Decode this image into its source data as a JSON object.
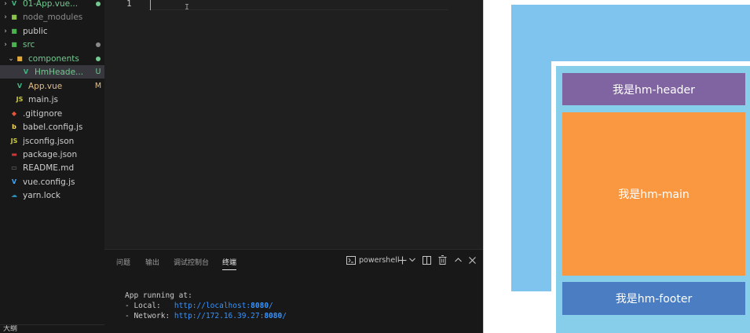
{
  "explorer": {
    "items": [
      {
        "label": "01-App.vue...",
        "type": "vue",
        "color": "green",
        "dot": "#73c991",
        "chevron": "›"
      },
      {
        "label": "node_modules",
        "type": "folder-node",
        "color": "gray",
        "chevron": "›"
      },
      {
        "label": "public",
        "type": "folder-public",
        "color": "",
        "chevron": "›"
      },
      {
        "label": "src",
        "type": "folder-src",
        "color": "green",
        "dot": "#8a8a8a",
        "chevron": "›"
      },
      {
        "label": "components",
        "type": "folder-components",
        "color": "green",
        "dot": "#73c991",
        "chevron": "⌄"
      },
      {
        "label": "HmHeade...",
        "type": "vue",
        "color": "green",
        "badge": "U",
        "badge_color": "green",
        "selected": true
      },
      {
        "label": "App.vue",
        "type": "vue",
        "color": "orange",
        "badge": "M",
        "badge_color": "orange"
      },
      {
        "label": "main.js",
        "type": "js",
        "color": ""
      },
      {
        "label": ".gitignore",
        "type": "git",
        "color": ""
      },
      {
        "label": "babel.config.js",
        "type": "babel",
        "color": ""
      },
      {
        "label": "jsconfig.json",
        "type": "js",
        "color": ""
      },
      {
        "label": "package.json",
        "type": "npm",
        "color": ""
      },
      {
        "label": "README.md",
        "type": "info",
        "color": ""
      },
      {
        "label": "vue.config.js",
        "type": "vue-config",
        "color": ""
      },
      {
        "label": "yarn.lock",
        "type": "yarn",
        "color": ""
      }
    ],
    "outline_label": "大纲"
  },
  "editor": {
    "line_number": "1",
    "ibeam": "I"
  },
  "panel": {
    "tabs": [
      "问题",
      "输出",
      "调试控制台",
      "终端"
    ],
    "active_tab": 3,
    "shell_label": "powershell",
    "terminal": {
      "line1": "App running at:",
      "local_label": "- Local:   ",
      "local_url": "http://localhost:",
      "local_port": "8080",
      "local_tail": "/",
      "network_label": "- Network: ",
      "network_url": "http://172.16.39.27:",
      "network_port": "8080",
      "network_tail": "/"
    }
  },
  "preview": {
    "header_text": "我是hm-header",
    "main_text": "我是hm-main",
    "footer_text": "我是hm-footer"
  },
  "colors": {
    "vue": "#41b883",
    "js": "#cbcb41",
    "git": "#e8543a",
    "npm": "#cb3837",
    "accent_link": "#3794ff"
  }
}
